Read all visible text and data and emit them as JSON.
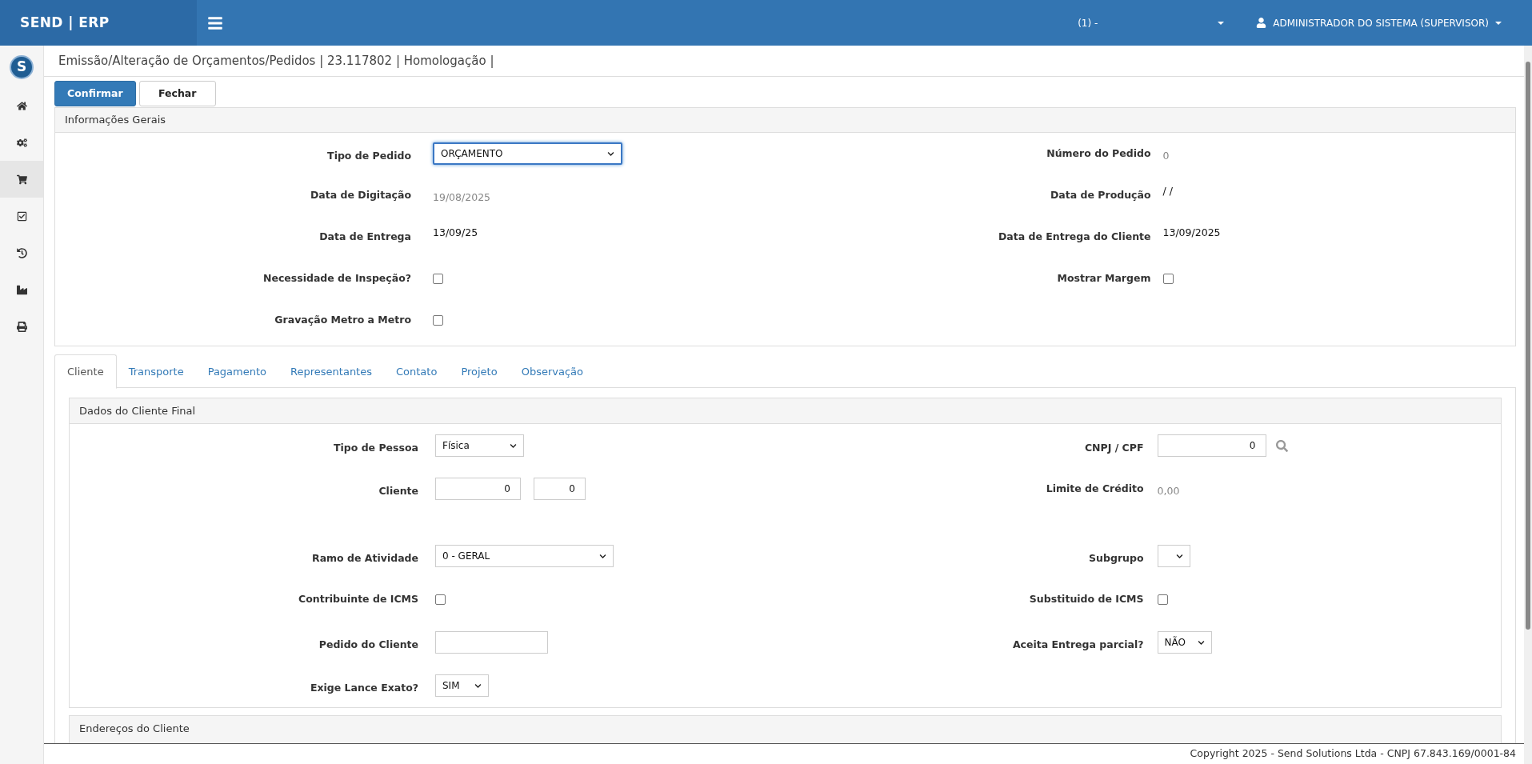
{
  "topbar": {
    "brand": "SEND | ERP",
    "company": "(1) -",
    "user": "ADMINISTRADOR DO SISTEMA (SUPERVISOR)"
  },
  "sidebar": {
    "logo": "S",
    "items": [
      {
        "selected": false
      },
      {
        "selected": false
      },
      {
        "selected": true
      },
      {
        "selected": false
      },
      {
        "selected": false
      },
      {
        "selected": false
      },
      {
        "selected": false
      }
    ]
  },
  "page_title": "Emissão/Alteração de Orçamentos/Pedidos | 23.117802 | Homologação |",
  "buttons": [
    {
      "label": "Confirmar",
      "kind": "primary"
    },
    {
      "label": "Fechar",
      "kind": "default"
    }
  ],
  "general_panel": {
    "title": "Informações Gerais",
    "rows": [
      {
        "left": {
          "label": "Tipo de Pedido",
          "kind": "select",
          "value": "ORÇAMENTO",
          "focused": true
        },
        "right": {
          "label": "Número do Pedido",
          "kind": "text",
          "value": "0",
          "muted": true
        }
      },
      {
        "left": {
          "label": "Data de Digitação",
          "kind": "text",
          "value": "19/08/2025",
          "muted": true
        },
        "right": {
          "label": "Data de Produção",
          "kind": "text",
          "value": "/ /",
          "muted": false
        }
      },
      {
        "left": {
          "label": "Data de Entrega",
          "kind": "text",
          "value": "13/09/25",
          "muted": false
        },
        "right": {
          "label": "Data de Entrega do Cliente",
          "kind": "text",
          "value": "13/09/2025",
          "muted": false
        }
      },
      {
        "left": {
          "label": "Necessidade de Inspeção?",
          "kind": "checkbox",
          "checked": false
        },
        "right": {
          "label": "Mostrar Margem",
          "kind": "checkbox",
          "checked": false
        }
      },
      {
        "left": {
          "label": "Gravação Metro a Metro",
          "kind": "checkbox",
          "checked": false
        }
      }
    ]
  },
  "tabs": [
    {
      "label": "Cliente",
      "selected": true
    },
    {
      "label": "Transporte",
      "selected": false
    },
    {
      "label": "Pagamento",
      "selected": false
    },
    {
      "label": "Representantes",
      "selected": false
    },
    {
      "label": "Contato",
      "selected": false
    },
    {
      "label": "Projeto",
      "selected": false
    },
    {
      "label": "Observação",
      "selected": false
    }
  ],
  "client_panel": {
    "title": "Dados do Cliente Final",
    "rows": [
      {
        "left": {
          "label": "Tipo de Pessoa",
          "kind": "select",
          "value": "Física",
          "focused": false
        },
        "right": {
          "label": "CNPJ / CPF",
          "kind": "search",
          "value": "0"
        }
      },
      {
        "left": {
          "label": "Cliente",
          "kind": "inputs",
          "values": [
            "0",
            "0"
          ]
        },
        "right": {
          "label": "Limite de Crédito",
          "kind": "text",
          "value": "0,00",
          "muted": true
        }
      },
      {
        "left": {
          "label": "Ramo de Atividade",
          "kind": "select",
          "value": "0 - GERAL",
          "focused": false
        },
        "right": {
          "label": "Subgrupo",
          "kind": "select",
          "focused": false
        }
      },
      {
        "left": {
          "label": "Contribuinte de ICMS",
          "kind": "checkbox",
          "checked": false
        },
        "right": {
          "label": "Substituido de ICMS",
          "kind": "checkbox",
          "checked": false
        }
      },
      {
        "left": {
          "label": "Pedido do Cliente",
          "kind": "input"
        },
        "right": {
          "label": "Aceita Entrega parcial?",
          "kind": "select",
          "value": "NÃO",
          "focused": false
        }
      },
      {
        "left": {
          "label": "Exige Lance Exato?",
          "kind": "select",
          "value": "SIM",
          "focused": false
        }
      }
    ]
  },
  "address_panel": {
    "title": "Endereços do Cliente"
  },
  "footer": {
    "copyright": "Copyright 2025 - Send Solutions Ltda - CNPJ 67.843.169/0001-84"
  }
}
